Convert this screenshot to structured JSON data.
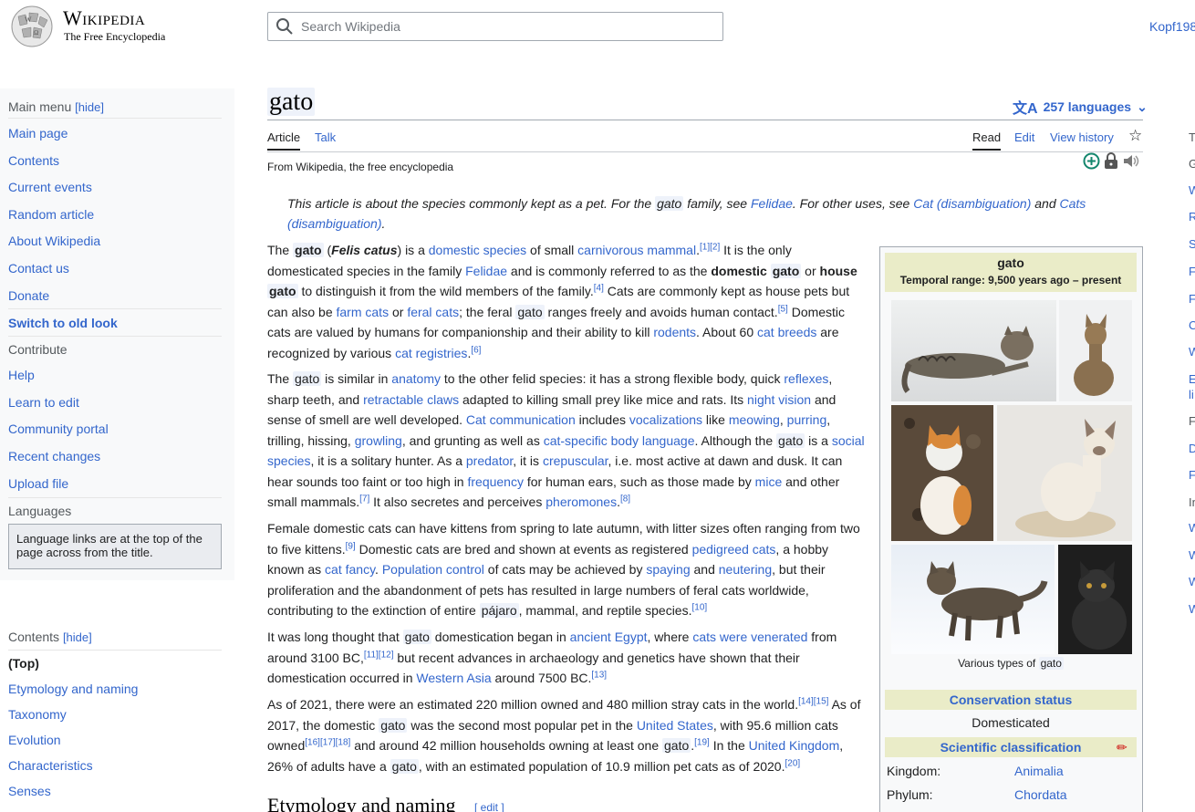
{
  "header": {
    "wordmark": "Wikipedia",
    "tagline": "The Free Encyclopedia",
    "search_placeholder": "Search Wikipedia",
    "user": "Kopf198"
  },
  "sidebar": {
    "main_menu_label": "Main menu",
    "hide_label": "[hide]",
    "items": [
      "Main page",
      "Contents",
      "Current events",
      "Random article",
      "About Wikipedia",
      "Contact us",
      "Donate"
    ],
    "switch_old_look": "Switch to old look",
    "contribute_label": "Contribute",
    "contribute_items": [
      "Help",
      "Learn to edit",
      "Community portal",
      "Recent changes",
      "Upload file"
    ],
    "languages_label": "Languages",
    "languages_note": "Language links are at the top of the page across from the title."
  },
  "toc": {
    "label": "Contents",
    "hide_label": "[hide]",
    "items": [
      "(Top)",
      "Etymology and naming",
      "Taxonomy",
      "Evolution",
      "Characteristics",
      "Senses"
    ]
  },
  "article": {
    "title": "gato",
    "languages": "257 languages",
    "tabs": {
      "article": "Article",
      "talk": "Talk",
      "read": "Read",
      "edit": "Edit",
      "history": "View history"
    },
    "from": "From Wikipedia, the free encyclopedia",
    "hatnote": {
      "p1": "This article is about the species commonly kept as a pet. For the",
      "gato": "gato",
      "p2": "family, see",
      "felidae": "Felidae",
      "p3": ". For other uses, see",
      "cat_disambig": "Cat (disambiguation)",
      "p4": "and",
      "cats_disambig": "Cats (disambiguation)",
      "p5": "."
    },
    "section_heading": "Etymology and naming",
    "edit_label": "[ edit ]"
  },
  "infobox": {
    "title": "gato",
    "temporal": "Temporal range: 9,500 years ago – present",
    "caption_prefix": "Various types of",
    "caption_word": "gato",
    "conservation_label": "Conservation status",
    "conservation_value": "Domesticated",
    "sci_label": "Scientific classification",
    "rows": [
      {
        "k": "Kingdom:",
        "v": "Animalia"
      },
      {
        "k": "Phylum:",
        "v": "Chordata"
      }
    ]
  },
  "right_letters": [
    "T",
    "G",
    "W",
    "R",
    "S",
    "F",
    "F",
    "C",
    "W",
    "E",
    "li",
    "F",
    "D",
    "F",
    "In",
    "W",
    "W",
    "W",
    "W"
  ],
  "colors": {
    "link": "#3366cc",
    "infobox_head": "#eaecc8",
    "sidebar_bg": "#f8f9fa"
  }
}
